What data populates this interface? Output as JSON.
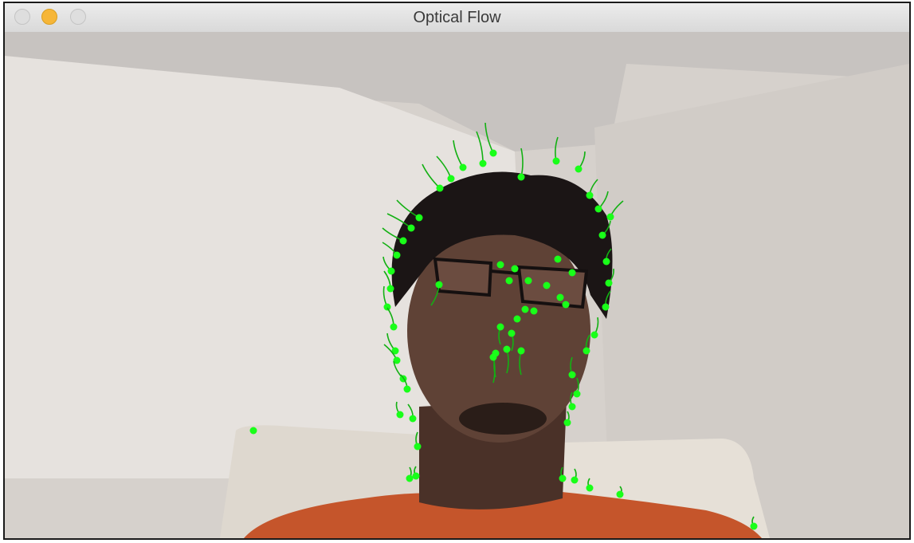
{
  "window": {
    "title": "Optical Flow",
    "buttons": [
      {
        "name": "close",
        "color": "#dedede"
      },
      {
        "name": "minimize",
        "color": "#f6b638"
      },
      {
        "name": "zoom",
        "color": "#dedede"
      }
    ]
  },
  "video": {
    "description_colors": {
      "wall_left": "#e7e3df",
      "wall_right": "#d6d1cc",
      "ceiling": "#c2bebb",
      "shirt": "#c5552b",
      "chair": "#ded8cf",
      "hair": "#1b1515",
      "skin": "#5f4236",
      "track_point": "#19ff19",
      "track_line": "#13b013"
    }
  }
}
